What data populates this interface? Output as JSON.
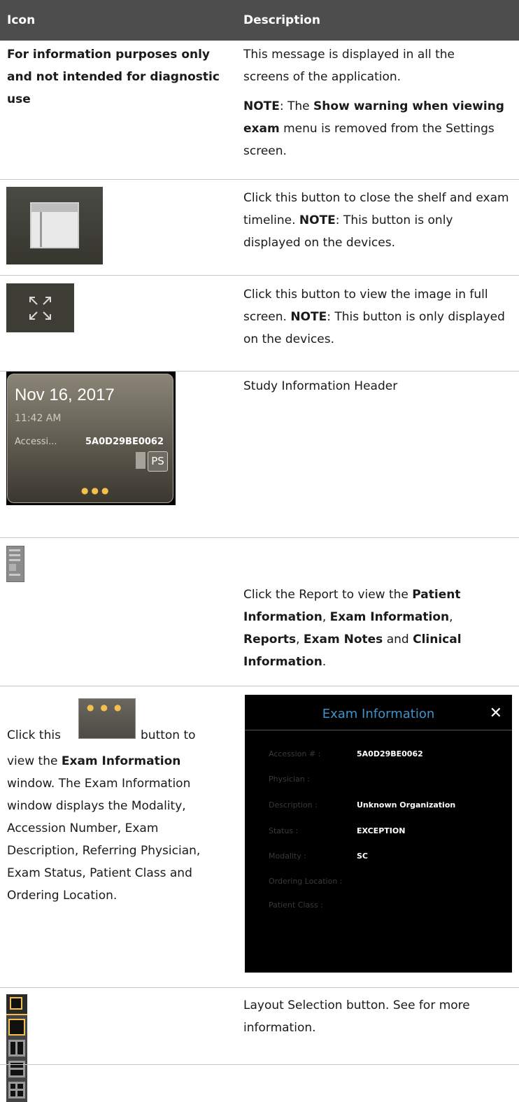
{
  "table": {
    "header_icon": "Icon",
    "header_description": "Description"
  },
  "row1": {
    "left_text": "For information purposes only and not intended for diagnostic use",
    "desc_p1": "This message is displayed in all the screens of the application.",
    "note_label": "NOTE",
    "note_text_1": ": The ",
    "note_bold": "Show warning when viewing exam",
    "note_text_2": " menu is removed from the Settings screen."
  },
  "row2": {
    "icon_name": "panel-layout-icon",
    "desc_1": "Click this button to close the shelf and exam timeline. ",
    "note_label": "NOTE",
    "desc_2": ": This button is only displayed on the devices."
  },
  "row3": {
    "icon_name": "fullscreen-expand-icon",
    "desc_1": "Click this button to view the image in full screen. ",
    "note_label": "NOTE",
    "desc_2": ": This button is only displayed on the devices."
  },
  "row4": {
    "card_date": "Nov 16, 2017",
    "card_time": "11:42 AM",
    "card_acc_label": "Accessi...",
    "card_acc_value": "5A0D29BE0062",
    "card_badge": "PS",
    "desc": "Study Information Header"
  },
  "row5": {
    "icon_name": "report-document-icon",
    "desc_1": "Click the Report to view the ",
    "b1": "Patient Information",
    "t1": ", ",
    "b2": "Exam Information",
    "t2": ", ",
    "b3": "Reports",
    "t3": ", ",
    "b4": "Exam Notes",
    "t4": " and ",
    "b5": "Clinical Information",
    "t5": "."
  },
  "row6": {
    "left_1": "Click this",
    "left_2": "button to",
    "left_3": "view the ",
    "left_bold": "Exam Information",
    "left_4": "window. The Exam Information window displays the Modality, Accession Number, Exam Description, Referring Physician, Exam Status, Patient Class and Ordering Location.",
    "panel_title": "Exam Information",
    "panel_close": "✕",
    "fields": [
      {
        "label": "Accession # :",
        "value": "5A0D29BE0062"
      },
      {
        "label": "Physician :",
        "value": ""
      },
      {
        "label": "Description :",
        "value": "Unknown Organization"
      },
      {
        "label": "Status :",
        "value": "EXCEPTION"
      },
      {
        "label": "Modality :",
        "value": "SC"
      },
      {
        "label": "Ordering Location :",
        "value": ""
      },
      {
        "label": "Patient Class :",
        "value": ""
      }
    ]
  },
  "row7": {
    "icon_name": "layout-selection-icon",
    "desc": "Layout Selection button. See for more information."
  },
  "colors": {
    "header_bg": "#4d4d4d",
    "accent_gold": "#f2c04b",
    "dark_panel": "#000000"
  }
}
